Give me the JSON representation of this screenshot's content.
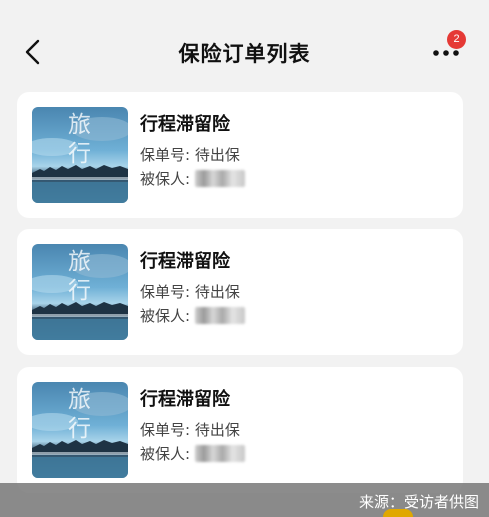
{
  "header": {
    "title": "保险订单列表",
    "back_icon": "chevron-left-icon",
    "more_icon": "more-dots-icon",
    "badge_count": "2",
    "badge_color": "#e53935"
  },
  "orders": [
    {
      "thumb_text": "旅\n行",
      "product_name": "行程滞留险",
      "policy_label": "保单号: ",
      "policy_status": "待出保",
      "insured_label": "被保人: "
    },
    {
      "thumb_text": "旅\n行",
      "product_name": "行程滞留险",
      "policy_label": "保单号: ",
      "policy_status": "待出保",
      "insured_label": "被保人: "
    },
    {
      "thumb_text": "旅\n行",
      "product_name": "行程滞留险",
      "policy_label": "保单号: ",
      "policy_status": "待出保",
      "insured_label": "被保人: "
    }
  ],
  "watermark": {
    "text": "来源：受访者供图"
  }
}
